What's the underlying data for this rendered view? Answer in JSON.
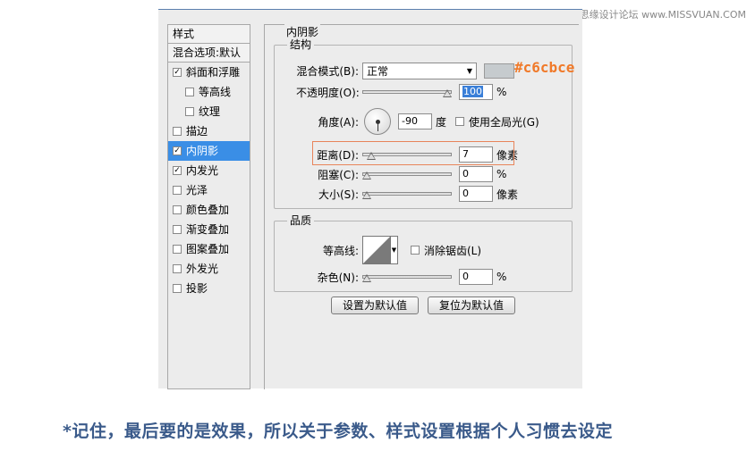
{
  "watermark": "思缘设计论坛 www.MISSVUAN.COM",
  "styles_panel": {
    "header": "样式",
    "blend_default": "混合选项:默认",
    "items": [
      {
        "label": "斜面和浮雕",
        "checked": true
      },
      {
        "label": "等高线",
        "checked": false
      },
      {
        "label": "纹理",
        "checked": false
      },
      {
        "label": "描边",
        "checked": false
      },
      {
        "label": "内阴影",
        "checked": true
      },
      {
        "label": "内发光",
        "checked": true
      },
      {
        "label": "光泽",
        "checked": false
      },
      {
        "label": "颜色叠加",
        "checked": false
      },
      {
        "label": "渐变叠加",
        "checked": false
      },
      {
        "label": "图案叠加",
        "checked": false
      },
      {
        "label": "外发光",
        "checked": false
      },
      {
        "label": "投影",
        "checked": false
      }
    ]
  },
  "inner_shadow": {
    "title": "内阴影",
    "structure": {
      "title": "结构",
      "blend_mode_label": "混合模式(B):",
      "blend_mode_value": "正常",
      "swatch_color": "#c6cbce",
      "swatch_note": "#c6cbce",
      "opacity_label": "不透明度(O):",
      "opacity_value": "100",
      "opacity_unit": "%",
      "opacity_level": 1.0,
      "angle_label": "角度(A):",
      "angle_value": "-90",
      "angle_unit": "度",
      "global_light_label": "使用全局光(G)",
      "global_light_checked": false,
      "distance_label": "距离(D):",
      "distance_value": "7",
      "distance_unit": "像素",
      "distance_level": 0.05,
      "choke_label": "阻塞(C):",
      "choke_value": "0",
      "choke_unit": "%",
      "choke_level": 0,
      "size_label": "大小(S):",
      "size_value": "0",
      "size_unit": "像素",
      "size_level": 0
    },
    "quality": {
      "title": "品质",
      "contour_label": "等高线:",
      "antialias_label": "消除锯齿(L)",
      "antialias_checked": false,
      "noise_label": "杂色(N):",
      "noise_value": "0",
      "noise_unit": "%",
      "noise_level": 0
    },
    "buttons": {
      "set_default": "设置为默认值",
      "reset_default": "复位为默认值"
    }
  },
  "caption": "*记住，最后要的是效果，所以关于参数、样式设置根据个人习惯去设定"
}
